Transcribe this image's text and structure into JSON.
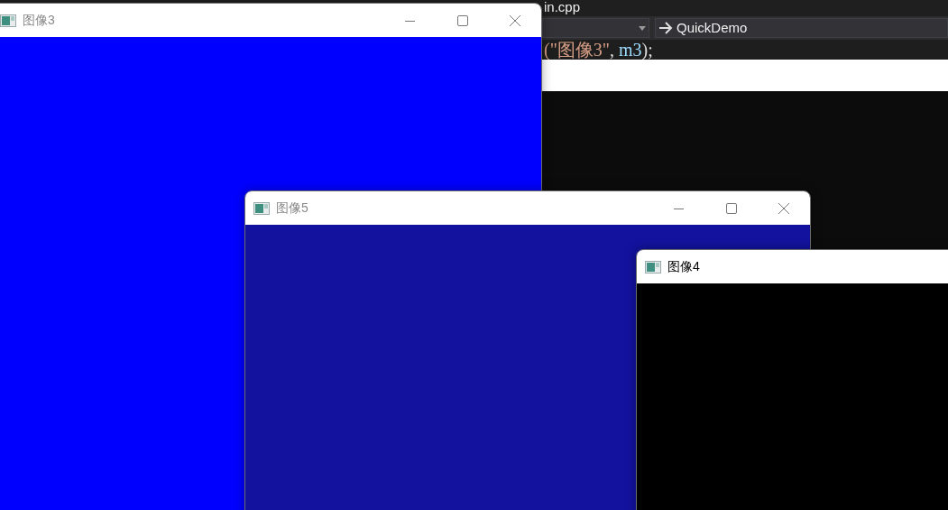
{
  "ide": {
    "file_tab": "in.cpp",
    "navigation": "QuickDemo",
    "code_tokens": [
      {
        "text": "(\"图像3\"",
        "kind": "string"
      },
      {
        "text": ", ",
        "kind": "punct"
      },
      {
        "text": "m3",
        "kind": "variable"
      },
      {
        "text": ");",
        "kind": "punct"
      }
    ]
  },
  "windows": [
    {
      "title": "图像3",
      "active": false,
      "color": "#0000ff",
      "caption_buttons": true
    },
    {
      "title": "图像5",
      "active": false,
      "color": "#12129e",
      "caption_buttons": true
    },
    {
      "title": "图像4",
      "active": true,
      "color": "#000000",
      "caption_buttons": false
    }
  ]
}
